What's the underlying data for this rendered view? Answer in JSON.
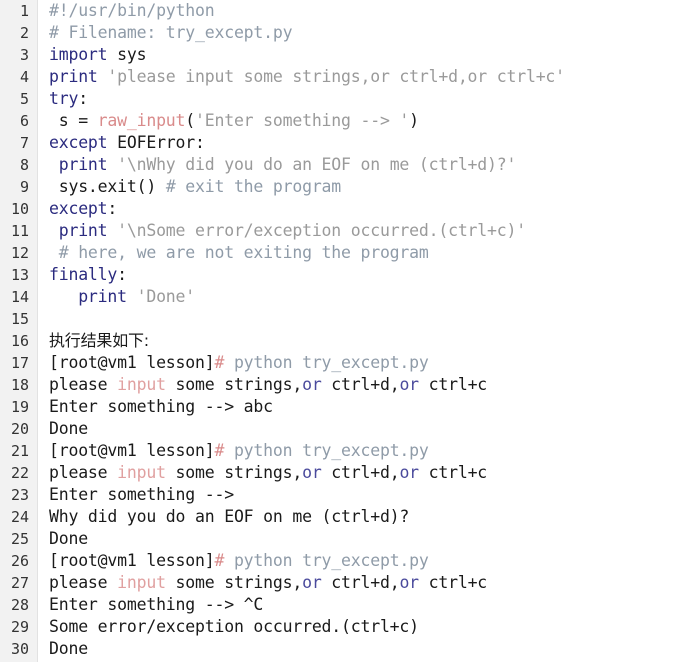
{
  "document": {
    "kind": "code-listing",
    "language": "python",
    "filename": "try_except.py",
    "total_lines": 30,
    "colors": {
      "background": "#ffffff",
      "gutter_background": "#f2f2f2",
      "gutter_border": "#e2e2e2",
      "line_number": "#333333",
      "plain": "#1a1a1a",
      "comment": "#8f9ba8",
      "keyword": "#2b2b7f",
      "string": "#9a9a9a",
      "function": "#d98b8b",
      "builtin": "#4a4a9c",
      "hash": "#d98b8b"
    }
  },
  "lines": [
    {
      "number": "1",
      "tokens": [
        {
          "t": "#!/usr/bin/python",
          "c": "comment"
        }
      ]
    },
    {
      "number": "2",
      "tokens": [
        {
          "t": "# Filename: try_except.py",
          "c": "comment"
        }
      ]
    },
    {
      "number": "3",
      "tokens": [
        {
          "t": "import",
          "c": "keyword"
        },
        {
          "t": " sys",
          "c": "plain"
        }
      ]
    },
    {
      "number": "4",
      "tokens": [
        {
          "t": "print",
          "c": "keyword"
        },
        {
          "t": " ",
          "c": "plain"
        },
        {
          "t": "'please input some strings,or ctrl+d,or ctrl+c'",
          "c": "string"
        }
      ]
    },
    {
      "number": "5",
      "tokens": [
        {
          "t": "try",
          "c": "keyword"
        },
        {
          "t": ":",
          "c": "plain"
        }
      ]
    },
    {
      "number": "6",
      "tokens": [
        {
          "t": " s = ",
          "c": "plain"
        },
        {
          "t": "raw_input",
          "c": "func"
        },
        {
          "t": "(",
          "c": "plain"
        },
        {
          "t": "'Enter something --> '",
          "c": "string"
        },
        {
          "t": ")",
          "c": "plain"
        }
      ]
    },
    {
      "number": "7",
      "tokens": [
        {
          "t": "except",
          "c": "keyword"
        },
        {
          "t": " EOFError:",
          "c": "plain"
        }
      ]
    },
    {
      "number": "8",
      "tokens": [
        {
          "t": " ",
          "c": "plain"
        },
        {
          "t": "print",
          "c": "keyword"
        },
        {
          "t": " ",
          "c": "plain"
        },
        {
          "t": "'\\nWhy did you do an EOF on me (ctrl+d)?'",
          "c": "string"
        }
      ]
    },
    {
      "number": "9",
      "tokens": [
        {
          "t": " sys.exit() ",
          "c": "plain"
        },
        {
          "t": "# exit the program",
          "c": "comment"
        }
      ]
    },
    {
      "number": "10",
      "tokens": [
        {
          "t": "except",
          "c": "keyword"
        },
        {
          "t": ":",
          "c": "plain"
        }
      ]
    },
    {
      "number": "11",
      "tokens": [
        {
          "t": " ",
          "c": "plain"
        },
        {
          "t": "print",
          "c": "keyword"
        },
        {
          "t": " ",
          "c": "plain"
        },
        {
          "t": "'\\nSome error/exception occurred.(ctrl+c)'",
          "c": "string"
        }
      ]
    },
    {
      "number": "12",
      "tokens": [
        {
          "t": " # here, we are not exiting the program",
          "c": "comment"
        }
      ]
    },
    {
      "number": "13",
      "tokens": [
        {
          "t": "finally",
          "c": "keyword"
        },
        {
          "t": ":",
          "c": "plain"
        }
      ]
    },
    {
      "number": "14",
      "tokens": [
        {
          "t": "   ",
          "c": "plain"
        },
        {
          "t": "print",
          "c": "keyword"
        },
        {
          "t": " ",
          "c": "plain"
        },
        {
          "t": "'Done'",
          "c": "string"
        }
      ]
    },
    {
      "number": "15",
      "tokens": [
        {
          "t": "",
          "c": "plain"
        }
      ]
    },
    {
      "number": "16",
      "tokens": [
        {
          "t": "执行结果如下:",
          "c": "cjk"
        }
      ]
    },
    {
      "number": "17",
      "tokens": [
        {
          "t": "[root@vm1 lesson]",
          "c": "prompt"
        },
        {
          "t": "#",
          "c": "hash"
        },
        {
          "t": " python try_except.py",
          "c": "cmd"
        }
      ]
    },
    {
      "number": "18",
      "tokens": [
        {
          "t": "please ",
          "c": "plain"
        },
        {
          "t": "input",
          "c": "pink"
        },
        {
          "t": " some strings,",
          "c": "plain"
        },
        {
          "t": "or",
          "c": "builtin"
        },
        {
          "t": " ctrl+d,",
          "c": "plain"
        },
        {
          "t": "or",
          "c": "builtin"
        },
        {
          "t": " ctrl+c",
          "c": "plain"
        }
      ]
    },
    {
      "number": "19",
      "tokens": [
        {
          "t": "Enter something --> abc",
          "c": "plain"
        }
      ]
    },
    {
      "number": "20",
      "tokens": [
        {
          "t": "Done",
          "c": "plain"
        }
      ]
    },
    {
      "number": "21",
      "tokens": [
        {
          "t": "[root@vm1 lesson]",
          "c": "prompt"
        },
        {
          "t": "#",
          "c": "hash"
        },
        {
          "t": " python try_except.py",
          "c": "cmd"
        }
      ]
    },
    {
      "number": "22",
      "tokens": [
        {
          "t": "please ",
          "c": "plain"
        },
        {
          "t": "input",
          "c": "pink"
        },
        {
          "t": " some strings,",
          "c": "plain"
        },
        {
          "t": "or",
          "c": "builtin"
        },
        {
          "t": " ctrl+d,",
          "c": "plain"
        },
        {
          "t": "or",
          "c": "builtin"
        },
        {
          "t": " ctrl+c",
          "c": "plain"
        }
      ]
    },
    {
      "number": "23",
      "tokens": [
        {
          "t": "Enter something -->",
          "c": "plain"
        }
      ]
    },
    {
      "number": "24",
      "tokens": [
        {
          "t": "Why did you do an EOF on me (ctrl+d)?",
          "c": "plain"
        }
      ]
    },
    {
      "number": "25",
      "tokens": [
        {
          "t": "Done",
          "c": "plain"
        }
      ]
    },
    {
      "number": "26",
      "tokens": [
        {
          "t": "[root@vm1 lesson]",
          "c": "prompt"
        },
        {
          "t": "#",
          "c": "hash"
        },
        {
          "t": " python try_except.py",
          "c": "cmd"
        }
      ]
    },
    {
      "number": "27",
      "tokens": [
        {
          "t": "please ",
          "c": "plain"
        },
        {
          "t": "input",
          "c": "pink"
        },
        {
          "t": " some strings,",
          "c": "plain"
        },
        {
          "t": "or",
          "c": "builtin"
        },
        {
          "t": " ctrl+d,",
          "c": "plain"
        },
        {
          "t": "or",
          "c": "builtin"
        },
        {
          "t": " ctrl+c",
          "c": "plain"
        }
      ]
    },
    {
      "number": "28",
      "tokens": [
        {
          "t": "Enter something --> ^C",
          "c": "plain"
        }
      ]
    },
    {
      "number": "29",
      "tokens": [
        {
          "t": "Some error/exception occurred.(ctrl+c)",
          "c": "plain"
        }
      ]
    },
    {
      "number": "30",
      "tokens": [
        {
          "t": "Done",
          "c": "plain"
        }
      ]
    }
  ]
}
